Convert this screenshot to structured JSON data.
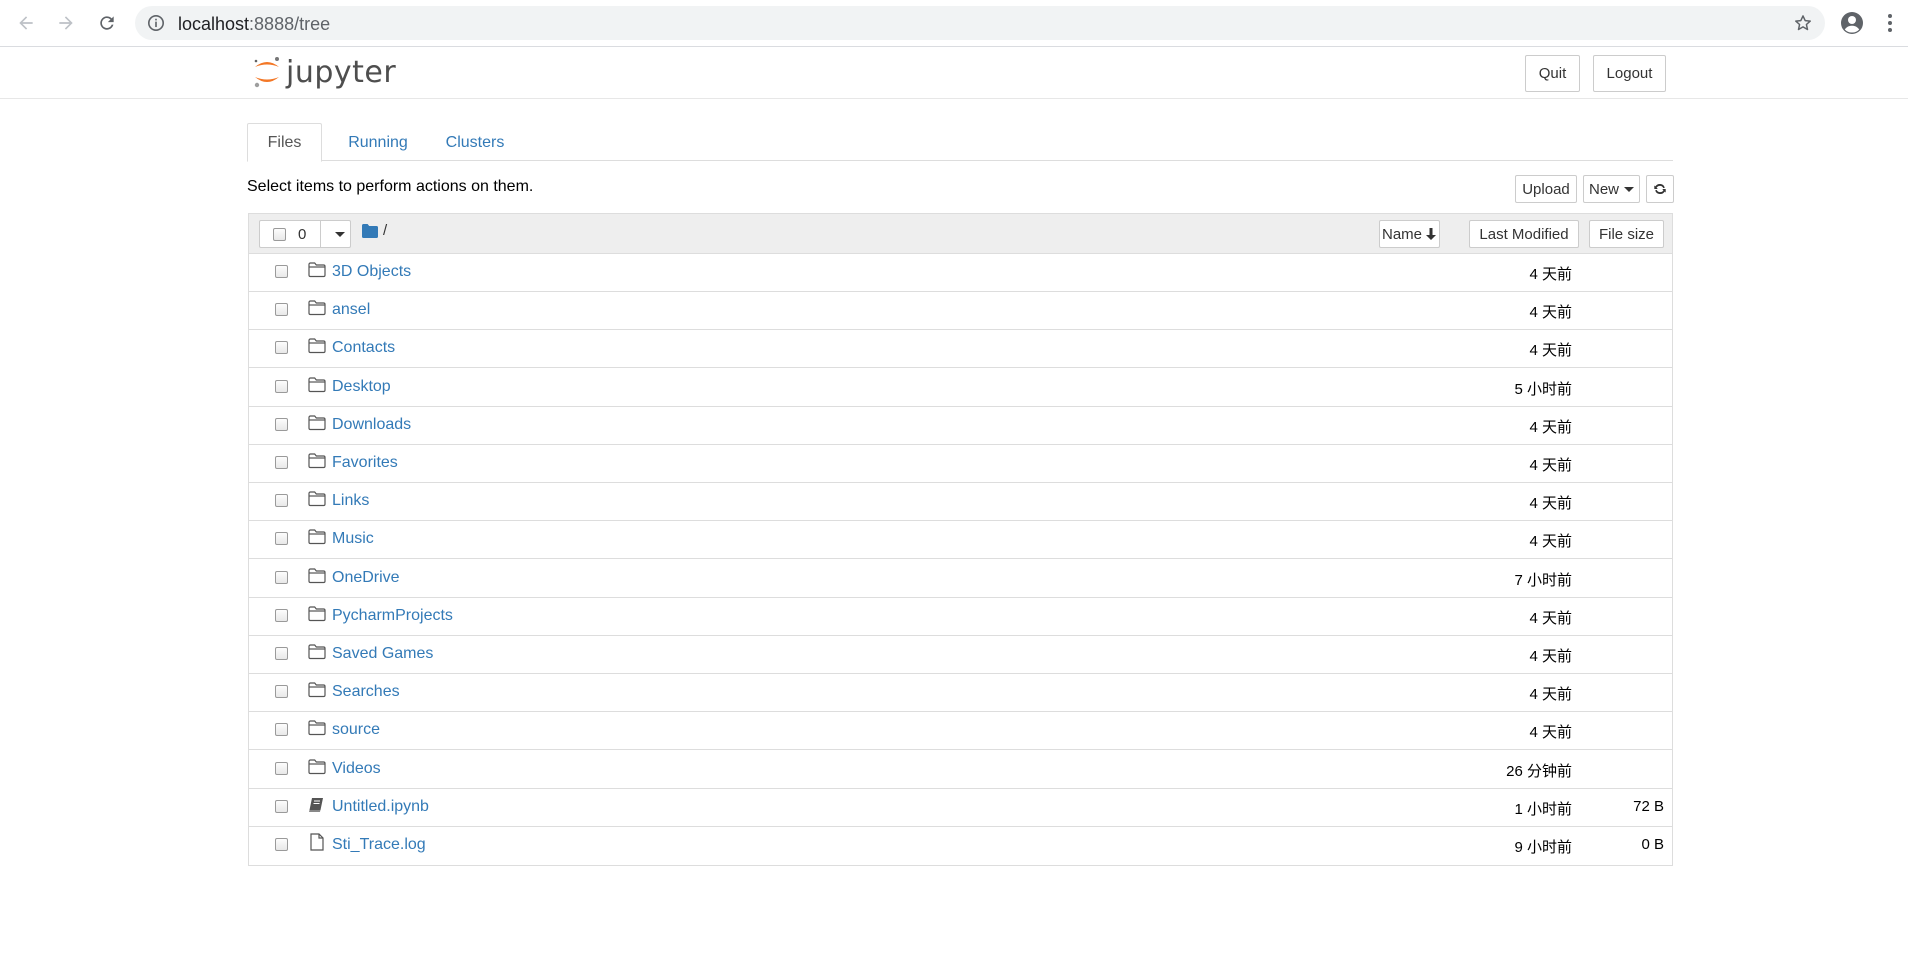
{
  "browser": {
    "url_host": "localhost",
    "url_path": ":8888/tree"
  },
  "header": {
    "logo_text": "jupyter",
    "quit_label": "Quit",
    "logout_label": "Logout"
  },
  "tabs": [
    {
      "label": "Files",
      "active": true
    },
    {
      "label": "Running",
      "active": false
    },
    {
      "label": "Clusters",
      "active": false
    }
  ],
  "toolbar": {
    "instructions": "Select items to perform actions on them.",
    "upload_label": "Upload",
    "new_label": "New"
  },
  "list_header": {
    "selected_count": "0",
    "breadcrumb": "/",
    "sort_name_label": "Name",
    "sort_modified_label": "Last Modified",
    "sort_size_label": "File size"
  },
  "items": [
    {
      "name": "3D Objects",
      "type": "folder",
      "modified": "4 天前",
      "size": ""
    },
    {
      "name": "ansel",
      "type": "folder",
      "modified": "4 天前",
      "size": ""
    },
    {
      "name": "Contacts",
      "type": "folder",
      "modified": "4 天前",
      "size": ""
    },
    {
      "name": "Desktop",
      "type": "folder",
      "modified": "5 小时前",
      "size": ""
    },
    {
      "name": "Downloads",
      "type": "folder",
      "modified": "4 天前",
      "size": ""
    },
    {
      "name": "Favorites",
      "type": "folder",
      "modified": "4 天前",
      "size": ""
    },
    {
      "name": "Links",
      "type": "folder",
      "modified": "4 天前",
      "size": ""
    },
    {
      "name": "Music",
      "type": "folder",
      "modified": "4 天前",
      "size": ""
    },
    {
      "name": "OneDrive",
      "type": "folder",
      "modified": "7 小时前",
      "size": ""
    },
    {
      "name": "PycharmProjects",
      "type": "folder",
      "modified": "4 天前",
      "size": ""
    },
    {
      "name": "Saved Games",
      "type": "folder",
      "modified": "4 天前",
      "size": ""
    },
    {
      "name": "Searches",
      "type": "folder",
      "modified": "4 天前",
      "size": ""
    },
    {
      "name": "source",
      "type": "folder",
      "modified": "4 天前",
      "size": ""
    },
    {
      "name": "Videos",
      "type": "folder",
      "modified": "26 分钟前",
      "size": ""
    },
    {
      "name": "Untitled.ipynb",
      "type": "notebook",
      "modified": "1 小时前",
      "size": "72 B"
    },
    {
      "name": "Sti_Trace.log",
      "type": "file",
      "modified": "9 小时前",
      "size": "0 B"
    }
  ],
  "colors": {
    "link": "#337ab7",
    "logo_orange": "#f37726",
    "folder_blue": "#337ab7"
  }
}
